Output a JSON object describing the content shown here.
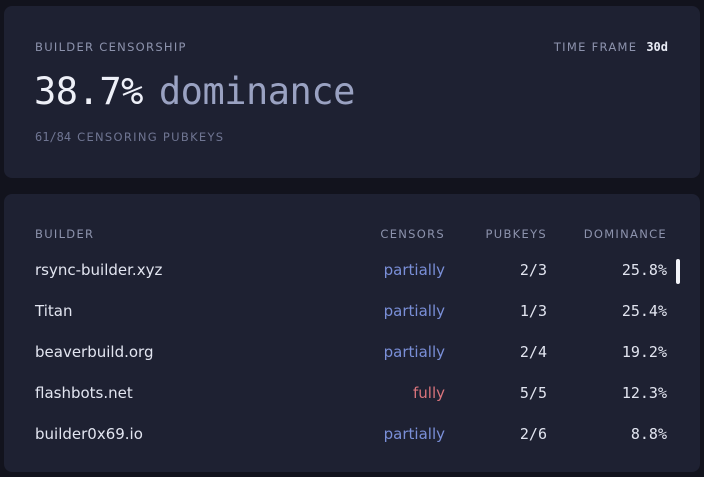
{
  "summary": {
    "title": "BUILDER CENSORSHIP",
    "timeframe_label": "TIME FRAME",
    "timeframe_value": "30d",
    "dominance_value": "38.7%",
    "dominance_word": "dominance",
    "censoring_count": "61/84",
    "censoring_label": "CENSORING PUBKEYS"
  },
  "table": {
    "headers": {
      "builder": "BUILDER",
      "censors": "CENSORS",
      "pubkeys": "PUBKEYS",
      "dominance": "DOMINANCE"
    },
    "rows": [
      {
        "builder": "rsync-builder.xyz",
        "censors": "partially",
        "pubkeys": "2/3",
        "dominance": "25.8%"
      },
      {
        "builder": "Titan",
        "censors": "partially",
        "pubkeys": "1/3",
        "dominance": "25.4%"
      },
      {
        "builder": "beaverbuild.org",
        "censors": "partially",
        "pubkeys": "2/4",
        "dominance": "19.2%"
      },
      {
        "builder": "flashbots.net",
        "censors": "fully",
        "pubkeys": "5/5",
        "dominance": "12.3%"
      },
      {
        "builder": "builder0x69.io",
        "censors": "partially",
        "pubkeys": "2/6",
        "dominance": "8.8%"
      }
    ]
  },
  "colors": {
    "partially": "#7a8fd8",
    "fully": "#d9747c"
  }
}
